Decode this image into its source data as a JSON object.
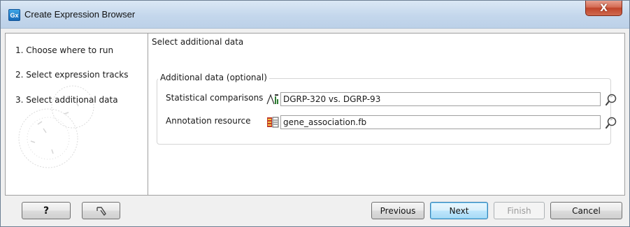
{
  "window": {
    "app_icon_label": "Gx",
    "title": "Create Expression Browser",
    "close_glyph": "X"
  },
  "steps": [
    {
      "number": "1.",
      "label": "Choose where to run"
    },
    {
      "number": "2.",
      "label": "Select expression tracks"
    },
    {
      "number": "3.",
      "label": "Select additional data"
    }
  ],
  "main": {
    "section_title": "Select additional data",
    "group_title": "Additional data (optional)",
    "rows": [
      {
        "label": "Statistical comparisons",
        "icon": "statistical-comparison-icon",
        "value": "DGRP-320 vs. DGRP-93"
      },
      {
        "label": "Annotation resource",
        "icon": "annotation-table-icon",
        "value": "gene_association.fb"
      }
    ]
  },
  "footer": {
    "help_label": "?",
    "reset_icon": "reset-arrow-icon",
    "previous_label": "Previous",
    "next_label": "Next",
    "finish_label": "Finish",
    "cancel_label": "Cancel"
  },
  "colors": {
    "titlebar": "#c4d7ec",
    "close_button": "#c0442a",
    "primary_button_border": "#3c7fb1"
  }
}
